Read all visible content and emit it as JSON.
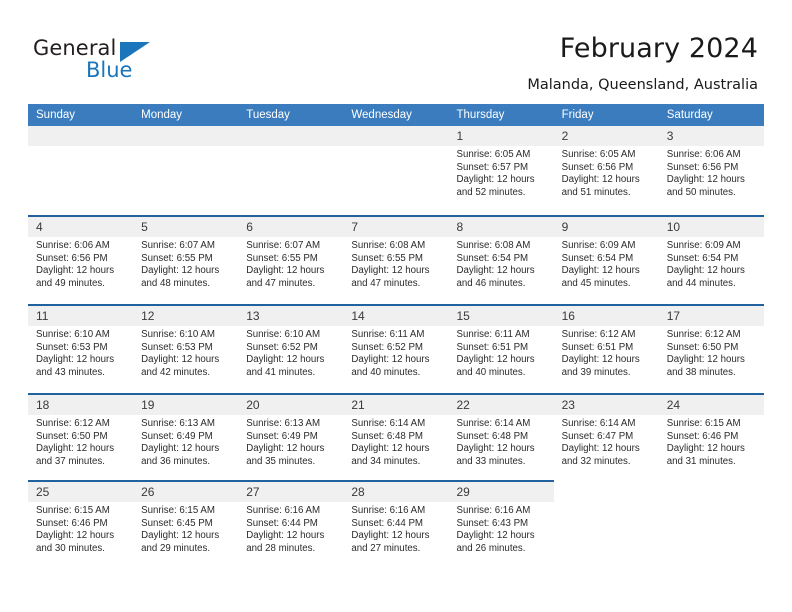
{
  "brand": {
    "name_part1": "General",
    "name_part2": "Blue",
    "triangle_icon": "triangle-icon",
    "accent_color": "#1b75bb"
  },
  "header": {
    "title": "February 2024",
    "subtitle": "Malanda, Queensland, Australia"
  },
  "colors": {
    "header_blue": "#3a7cbe",
    "rule_blue": "#20619e",
    "strip_gray": "#f0f0f0",
    "text": "#2b2b2b"
  },
  "weekdays": [
    "Sunday",
    "Monday",
    "Tuesday",
    "Wednesday",
    "Thursday",
    "Friday",
    "Saturday"
  ],
  "weeks": [
    [
      {
        "day": "",
        "lines": []
      },
      {
        "day": "",
        "lines": []
      },
      {
        "day": "",
        "lines": []
      },
      {
        "day": "",
        "lines": []
      },
      {
        "day": "1",
        "lines": [
          "Sunrise: 6:05 AM",
          "Sunset: 6:57 PM",
          "Daylight: 12 hours",
          "and 52 minutes."
        ]
      },
      {
        "day": "2",
        "lines": [
          "Sunrise: 6:05 AM",
          "Sunset: 6:56 PM",
          "Daylight: 12 hours",
          "and 51 minutes."
        ]
      },
      {
        "day": "3",
        "lines": [
          "Sunrise: 6:06 AM",
          "Sunset: 6:56 PM",
          "Daylight: 12 hours",
          "and 50 minutes."
        ]
      }
    ],
    [
      {
        "day": "4",
        "lines": [
          "Sunrise: 6:06 AM",
          "Sunset: 6:56 PM",
          "Daylight: 12 hours",
          "and 49 minutes."
        ]
      },
      {
        "day": "5",
        "lines": [
          "Sunrise: 6:07 AM",
          "Sunset: 6:55 PM",
          "Daylight: 12 hours",
          "and 48 minutes."
        ]
      },
      {
        "day": "6",
        "lines": [
          "Sunrise: 6:07 AM",
          "Sunset: 6:55 PM",
          "Daylight: 12 hours",
          "and 47 minutes."
        ]
      },
      {
        "day": "7",
        "lines": [
          "Sunrise: 6:08 AM",
          "Sunset: 6:55 PM",
          "Daylight: 12 hours",
          "and 47 minutes."
        ]
      },
      {
        "day": "8",
        "lines": [
          "Sunrise: 6:08 AM",
          "Sunset: 6:54 PM",
          "Daylight: 12 hours",
          "and 46 minutes."
        ]
      },
      {
        "day": "9",
        "lines": [
          "Sunrise: 6:09 AM",
          "Sunset: 6:54 PM",
          "Daylight: 12 hours",
          "and 45 minutes."
        ]
      },
      {
        "day": "10",
        "lines": [
          "Sunrise: 6:09 AM",
          "Sunset: 6:54 PM",
          "Daylight: 12 hours",
          "and 44 minutes."
        ]
      }
    ],
    [
      {
        "day": "11",
        "lines": [
          "Sunrise: 6:10 AM",
          "Sunset: 6:53 PM",
          "Daylight: 12 hours",
          "and 43 minutes."
        ]
      },
      {
        "day": "12",
        "lines": [
          "Sunrise: 6:10 AM",
          "Sunset: 6:53 PM",
          "Daylight: 12 hours",
          "and 42 minutes."
        ]
      },
      {
        "day": "13",
        "lines": [
          "Sunrise: 6:10 AM",
          "Sunset: 6:52 PM",
          "Daylight: 12 hours",
          "and 41 minutes."
        ]
      },
      {
        "day": "14",
        "lines": [
          "Sunrise: 6:11 AM",
          "Sunset: 6:52 PM",
          "Daylight: 12 hours",
          "and 40 minutes."
        ]
      },
      {
        "day": "15",
        "lines": [
          "Sunrise: 6:11 AM",
          "Sunset: 6:51 PM",
          "Daylight: 12 hours",
          "and 40 minutes."
        ]
      },
      {
        "day": "16",
        "lines": [
          "Sunrise: 6:12 AM",
          "Sunset: 6:51 PM",
          "Daylight: 12 hours",
          "and 39 minutes."
        ]
      },
      {
        "day": "17",
        "lines": [
          "Sunrise: 6:12 AM",
          "Sunset: 6:50 PM",
          "Daylight: 12 hours",
          "and 38 minutes."
        ]
      }
    ],
    [
      {
        "day": "18",
        "lines": [
          "Sunrise: 6:12 AM",
          "Sunset: 6:50 PM",
          "Daylight: 12 hours",
          "and 37 minutes."
        ]
      },
      {
        "day": "19",
        "lines": [
          "Sunrise: 6:13 AM",
          "Sunset: 6:49 PM",
          "Daylight: 12 hours",
          "and 36 minutes."
        ]
      },
      {
        "day": "20",
        "lines": [
          "Sunrise: 6:13 AM",
          "Sunset: 6:49 PM",
          "Daylight: 12 hours",
          "and 35 minutes."
        ]
      },
      {
        "day": "21",
        "lines": [
          "Sunrise: 6:14 AM",
          "Sunset: 6:48 PM",
          "Daylight: 12 hours",
          "and 34 minutes."
        ]
      },
      {
        "day": "22",
        "lines": [
          "Sunrise: 6:14 AM",
          "Sunset: 6:48 PM",
          "Daylight: 12 hours",
          "and 33 minutes."
        ]
      },
      {
        "day": "23",
        "lines": [
          "Sunrise: 6:14 AM",
          "Sunset: 6:47 PM",
          "Daylight: 12 hours",
          "and 32 minutes."
        ]
      },
      {
        "day": "24",
        "lines": [
          "Sunrise: 6:15 AM",
          "Sunset: 6:46 PM",
          "Daylight: 12 hours",
          "and 31 minutes."
        ]
      }
    ],
    [
      {
        "day": "25",
        "lines": [
          "Sunrise: 6:15 AM",
          "Sunset: 6:46 PM",
          "Daylight: 12 hours",
          "and 30 minutes."
        ]
      },
      {
        "day": "26",
        "lines": [
          "Sunrise: 6:15 AM",
          "Sunset: 6:45 PM",
          "Daylight: 12 hours",
          "and 29 minutes."
        ]
      },
      {
        "day": "27",
        "lines": [
          "Sunrise: 6:16 AM",
          "Sunset: 6:44 PM",
          "Daylight: 12 hours",
          "and 28 minutes."
        ]
      },
      {
        "day": "28",
        "lines": [
          "Sunrise: 6:16 AM",
          "Sunset: 6:44 PM",
          "Daylight: 12 hours",
          "and 27 minutes."
        ]
      },
      {
        "day": "29",
        "lines": [
          "Sunrise: 6:16 AM",
          "Sunset: 6:43 PM",
          "Daylight: 12 hours",
          "and 26 minutes."
        ]
      },
      {
        "day": "",
        "lines": []
      },
      {
        "day": "",
        "lines": []
      }
    ]
  ]
}
